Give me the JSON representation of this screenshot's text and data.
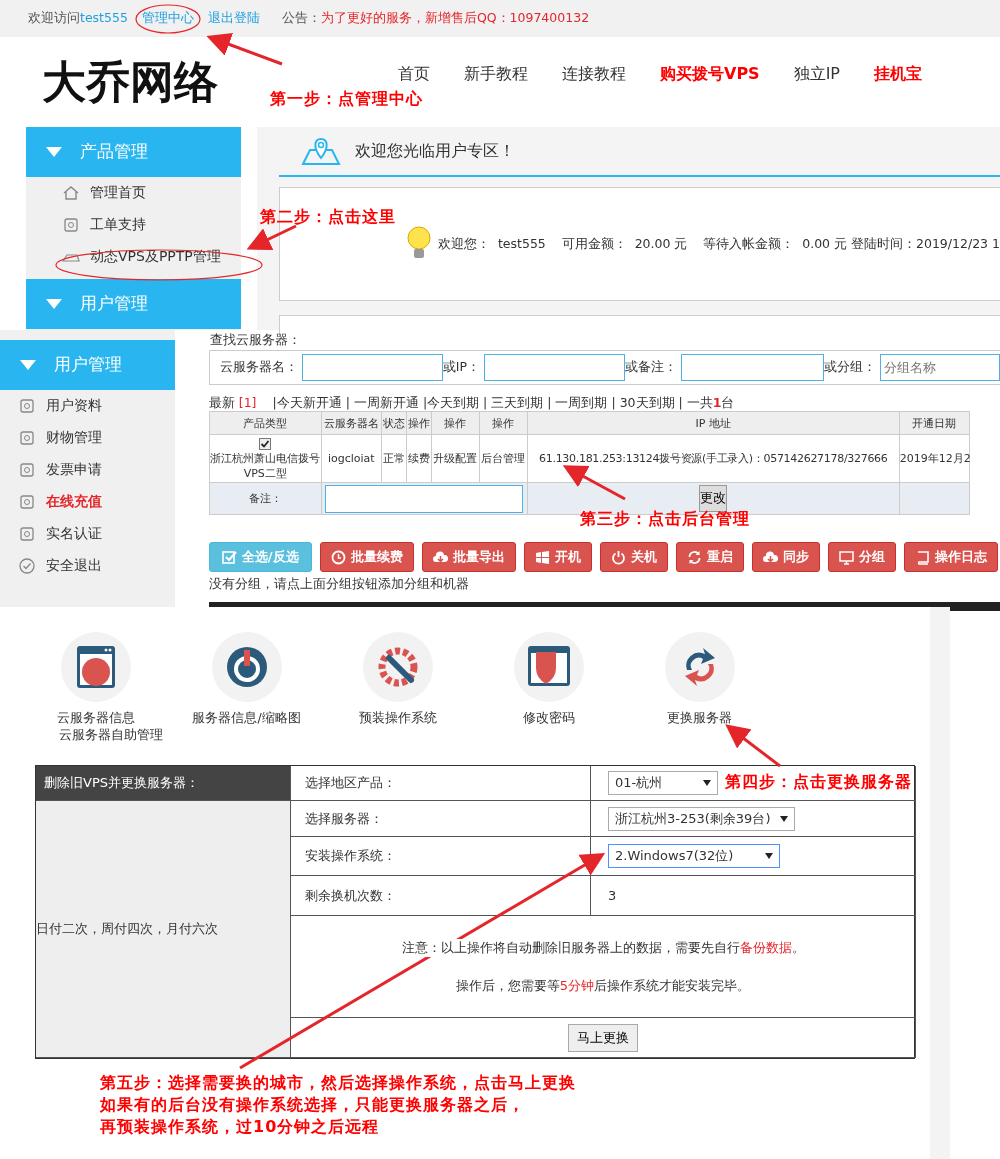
{
  "top_bar": {
    "welcome": "欢迎访问",
    "username": "test555",
    "links": [
      {
        "label": "管理中心"
      },
      {
        "label": "退出登陆"
      }
    ],
    "notice_label": "公告：",
    "notice": "为了更好的服务，新增售后QQ：1097400132"
  },
  "header": {
    "logo": "大乔网络",
    "nav": [
      {
        "label": "首页",
        "emphasized": false
      },
      {
        "label": "新手教程",
        "emphasized": false
      },
      {
        "label": "连接教程",
        "emphasized": false
      },
      {
        "label": "购买拨号VPS",
        "emphasized": true
      },
      {
        "label": "独立IP",
        "emphasized": false
      },
      {
        "label": "挂机宝",
        "emphasized": true
      }
    ]
  },
  "sidebar_1": {
    "groups": [
      {
        "title": "产品管理",
        "items": [
          {
            "label": "管理首页"
          },
          {
            "label": "工单支持"
          },
          {
            "label": "动态VPS及PPTP管理"
          }
        ]
      },
      {
        "title": "用户管理"
      }
    ]
  },
  "welcome_panel": {
    "title": "欢迎您光临用户专区！",
    "info": "欢迎您：  test555    可用金额：  20.00 元    等待入帐金额：  0.00 元 登陆时间：2019/12/23 1"
  },
  "sidebar_2": {
    "title": "用户管理",
    "items": [
      {
        "label": "用户资料",
        "active": false
      },
      {
        "label": "财物管理",
        "active": false
      },
      {
        "label": "发票申请",
        "active": false
      },
      {
        "label": "在线充值",
        "active": true
      },
      {
        "label": "实名认证",
        "active": false
      },
      {
        "label": "安全退出",
        "active": false
      }
    ]
  },
  "search": {
    "title": "查找云服务器：",
    "fields": [
      {
        "label": "云服务器名："
      },
      {
        "label": "或IP："
      },
      {
        "label": "或备注："
      },
      {
        "label": "或分组：",
        "placeholder": "分组名称"
      }
    ]
  },
  "filters": {
    "latest": "最新",
    "latest_count": "[1]",
    "links": [
      "|今天新开通",
      "| 一周新开通",
      "|今天到期",
      "| 三天到期",
      "| 一周到期",
      "| 30天到期"
    ],
    "total_prefix": "| 一共",
    "total": "1",
    "total_suffix": "台"
  },
  "table": {
    "columns": [
      "产品类型",
      "云服务器名",
      "状态",
      "操作",
      "操作",
      "操作",
      "IP 地址",
      "开通日期"
    ],
    "rows": [
      {
        "checked": true,
        "product": "浙江杭州萧山电信拨号VPS二型",
        "name": "iogcloiat",
        "status": "正常",
        "actions": [
          "续费",
          "升级配置",
          "后台管理"
        ],
        "ip": "61.130.181.253:13124拨号资源(手工录入)：057142627178/327666",
        "date": "2019年12月2"
      }
    ],
    "remark_label": "备注：",
    "remark_button": "更改"
  },
  "action_buttons": [
    {
      "label": "全选/反选",
      "kind": "info"
    },
    {
      "label": "批量续费",
      "kind": "danger"
    },
    {
      "label": "批量导出",
      "kind": "danger"
    },
    {
      "label": "开机",
      "kind": "danger"
    },
    {
      "label": "关机",
      "kind": "danger"
    },
    {
      "label": "重启",
      "kind": "danger"
    },
    {
      "label": "同步",
      "kind": "danger"
    },
    {
      "label": "分组",
      "kind": "danger"
    },
    {
      "label": "操作日志",
      "kind": "danger"
    }
  ],
  "group_hint": "没有分组，请点上面分组按钮添加分组和机器",
  "tools": [
    {
      "label": "云服务器信息",
      "sub": "云服务器自助管理"
    },
    {
      "label": "服务器信息/缩略图"
    },
    {
      "label": "预装操作系统"
    },
    {
      "label": "修改密码"
    },
    {
      "label": "更换服务器"
    }
  ],
  "replace_form": {
    "title": "删除旧VPS并更换服务器：",
    "side_note": "日付二次，周付四次，月付六次",
    "rows": [
      {
        "label": "选择地区产品：",
        "kind": "select",
        "value": "01-杭州",
        "focused": false
      },
      {
        "label": "选择服务器：",
        "kind": "select",
        "value": "浙江杭州3-253(剩余39台)",
        "focused": false
      },
      {
        "label": "安装操作系统：",
        "kind": "select",
        "value": "2.Windows7(32位)",
        "focused": true
      },
      {
        "label": "剩余换机次数：",
        "kind": "text",
        "value": "3"
      }
    ],
    "notices": [
      "注意：以上操作将自动删除旧服务器上的数据，需要先自行**备份数据**。",
      "操作后，您需要等**5分钟**后操作系统才能安装完毕。"
    ],
    "submit": "马上更换"
  },
  "annotations": [
    {
      "lines": [
        "第一步：点管理中心"
      ]
    },
    {
      "lines": [
        "第二步：点击这里"
      ]
    },
    {
      "lines": [
        "第三步：点击后台管理"
      ]
    },
    {
      "lines": [
        "第四步：点击更换服务器"
      ]
    },
    {
      "lines": [
        "第五步：选择需要换的城市，然后选择操作系统，点击马上更换",
        "如果有的后台没有操作系统选择，只能更换服务器之后，",
        "再预装操作系统，过10分钟之后远程"
      ]
    }
  ]
}
